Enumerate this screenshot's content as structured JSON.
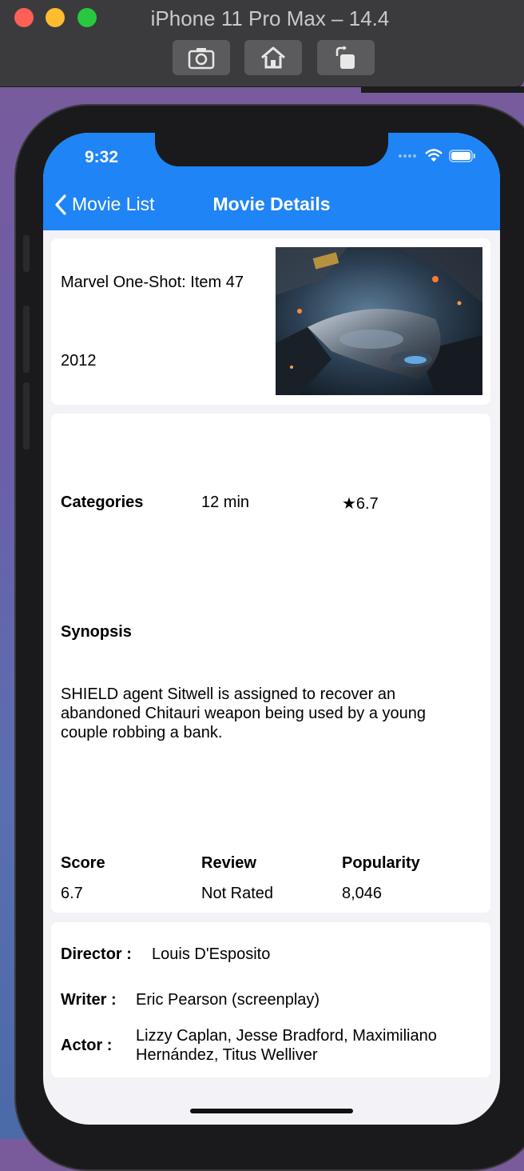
{
  "simulator": {
    "title": "iPhone 11 Pro Max – 14.4",
    "buttons": [
      "screenshot-icon",
      "home-icon",
      "rotate-icon"
    ]
  },
  "status_bar": {
    "time": "9:32"
  },
  "nav": {
    "back_label": "Movie List",
    "title": "Movie Details"
  },
  "movie": {
    "title": "Marvel One-Shot: Item 47",
    "year": "2012",
    "categories_label": "Categories",
    "runtime": "12 min",
    "rating": "★6.7",
    "synopsis_label": "Synopsis",
    "synopsis": "SHIELD agent Sitwell is assigned to recover an abandoned Chitauri weapon being used by a young couple robbing a bank.",
    "stats": {
      "score_label": "Score",
      "score": "6.7",
      "review_label": "Review",
      "review": "Not Rated",
      "popularity_label": "Popularity",
      "popularity": "8,046"
    },
    "credits": {
      "director_label": "Director :",
      "director": "Louis D'Esposito",
      "writer_label": "Writer :",
      "writer": "Eric Pearson (screenplay)",
      "actor_label": "Actor :",
      "actor": "Lizzy Caplan, Jesse Bradford, Maximiliano Hernández, Titus Welliver"
    }
  },
  "colors": {
    "nav_blue": "#1f84f6",
    "background": "#f2f2f7"
  }
}
